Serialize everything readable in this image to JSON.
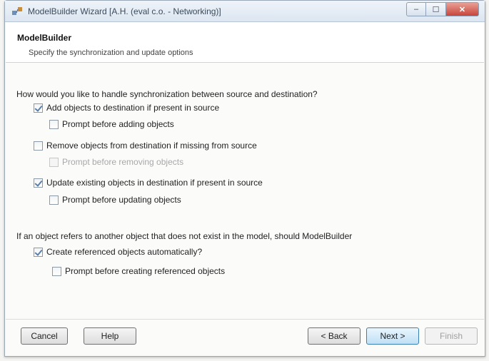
{
  "window": {
    "title": "ModelBuilder Wizard [A.H. (eval c.o. - Networking)]",
    "controls": {
      "minimize": "–",
      "maximize": "☐",
      "close": "✕"
    }
  },
  "header": {
    "title": "ModelBuilder",
    "subtitle": "Specify the synchronization and update options"
  },
  "question_sync": "How would you like to handle synchronization between source and destination?",
  "options": {
    "add": {
      "label": "Add objects to destination if present in source",
      "checked": true
    },
    "add_prompt": {
      "label": "Prompt before adding objects",
      "checked": false
    },
    "remove": {
      "label": "Remove objects from destination if missing from source",
      "checked": false
    },
    "remove_prompt": {
      "label": "Prompt before removing objects",
      "checked": false
    },
    "update": {
      "label": "Update existing objects in destination if present in source",
      "checked": true
    },
    "update_prompt": {
      "label": "Prompt before updating objects",
      "checked": false
    }
  },
  "question_ref": "If an object refers to another object that does not exist in the model, should ModelBuilder",
  "ref_options": {
    "create": {
      "label": "Create referenced objects automatically?",
      "checked": true
    },
    "create_prompt": {
      "label": "Prompt before creating referenced objects",
      "checked": false
    }
  },
  "buttons": {
    "cancel": "Cancel",
    "help": "Help",
    "back": "< Back",
    "next": "Next >",
    "finish": "Finish"
  }
}
